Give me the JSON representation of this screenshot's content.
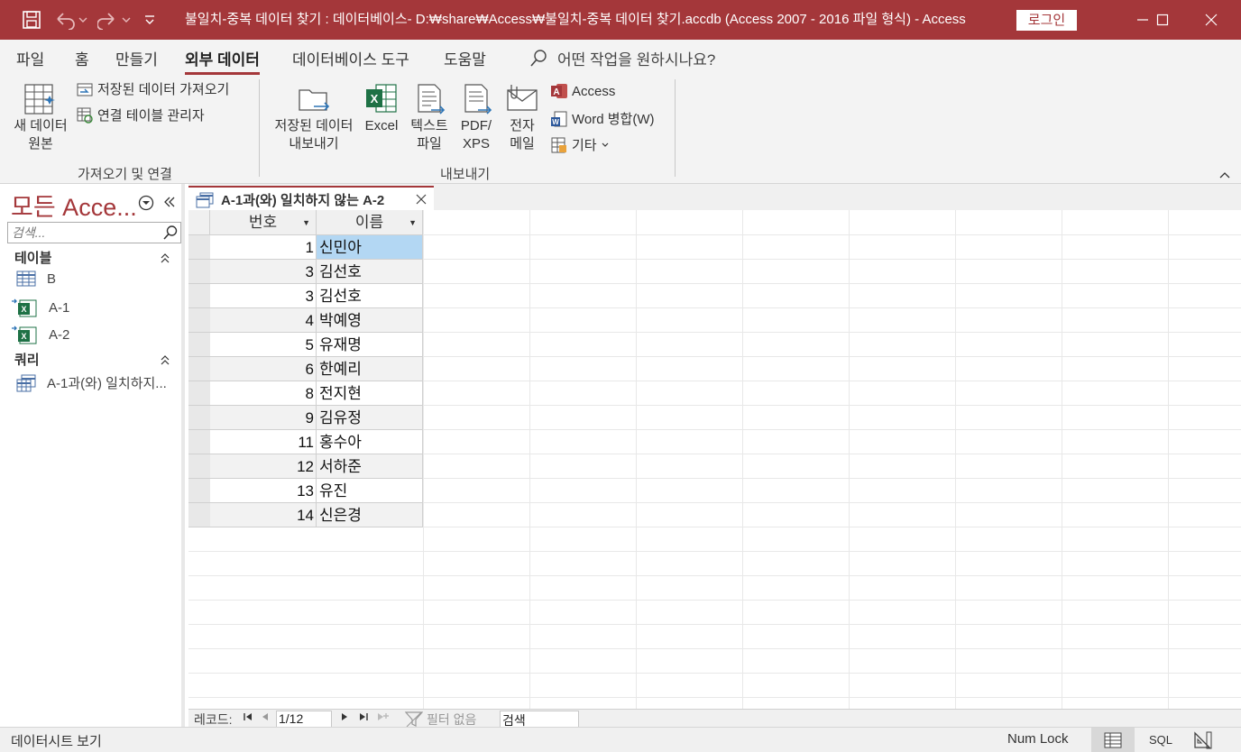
{
  "title_bar": {
    "title": "불일치-중복 데이터 찾기 : 데이터베이스- D:₩share₩Access₩불일치-중복 데이터 찾기.accdb (Access 2007 - 2016 파일 형식)  -  Access",
    "login_label": "로그인"
  },
  "tabs": [
    "파일",
    "홈",
    "만들기",
    "외부 데이터",
    "데이터베이스 도구",
    "도움말"
  ],
  "tell_me": "어떤 작업을 원하시나요?",
  "ribbon": {
    "new_data_source": "새 데이터",
    "new_data_source_2": "원본",
    "saved_imports": "저장된 데이터 가져오기",
    "linked_table_manager": "연결 테이블 관리자",
    "group_import": "가져오기 및 연결",
    "saved_exports": "저장된 데이터",
    "saved_exports_2": "내보내기",
    "excel": "Excel",
    "text_file": "텍스트",
    "text_file_2": "파일",
    "pdf_xps": "PDF/",
    "pdf_xps_2": "XPS",
    "email": "전자",
    "email_2": "메일",
    "access": "Access",
    "word_merge": "Word 병합(W)",
    "more": "기타",
    "group_export": "내보내기"
  },
  "nav_pane": {
    "title": "모든 Acce...",
    "search_placeholder": "검색...",
    "section_tables": "테이블",
    "tables": [
      "B",
      "A-1",
      "A-2"
    ],
    "section_queries": "쿼리",
    "queries": [
      "A-1과(와) 일치하지..."
    ]
  },
  "document_tab": "A-1과(와) 일치하지 않는 A-2",
  "datasheet": {
    "columns": [
      "번호",
      "이름"
    ],
    "rows": [
      [
        "1",
        "신민아"
      ],
      [
        "3",
        "김선호"
      ],
      [
        "3",
        "김선호"
      ],
      [
        "4",
        "박예영"
      ],
      [
        "5",
        "유재명"
      ],
      [
        "6",
        "한예리"
      ],
      [
        "8",
        "전지현"
      ],
      [
        "9",
        "김유정"
      ],
      [
        "11",
        "홍수아"
      ],
      [
        "12",
        "서하준"
      ],
      [
        "13",
        "유진"
      ],
      [
        "14",
        "신은경"
      ]
    ]
  },
  "record_nav": {
    "label": "레코드:",
    "position": "1/12",
    "filter": "필터 없음",
    "search": "검색"
  },
  "status_bar": {
    "view": "데이터시트 보기",
    "num_lock": "Num Lock",
    "sql": "SQL"
  },
  "colors": {
    "accent": "#a4373a",
    "selected_cell": "#b3d7f3"
  }
}
